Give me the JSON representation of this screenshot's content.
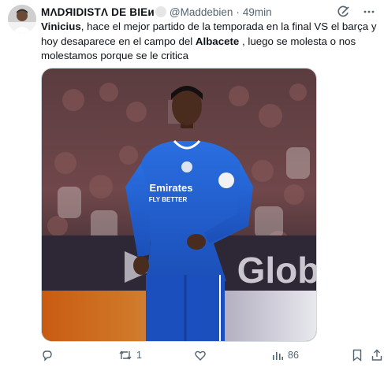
{
  "tweet": {
    "display_name": "MΛDЯIDISTΛ DE BIЕи",
    "handle": "@Maddebien",
    "separator": "·",
    "time": "49min",
    "text": {
      "bold_1": "Vinicius",
      "part_1": ", hace el mejor partido de la temporada en la final VS el barça y hoy desaparece en el campo del ",
      "bold_2": "Albacete",
      "part_2": " , luego se molesta o nos molestamos porque se le critica"
    },
    "media": {
      "jersey_text_1": "Emirates",
      "jersey_text_2": "FLY BETTER",
      "board_text": "Glob"
    },
    "actions": {
      "reply_count": "",
      "retweet_count": "1",
      "like_count": "",
      "views_count": "86"
    }
  },
  "icons": {
    "avatar": "avatar",
    "grok": "grok-icon",
    "more": "more-icon",
    "reply": "reply-icon",
    "retweet": "retweet-icon",
    "like": "heart-icon",
    "views": "views-icon",
    "bookmark": "bookmark-icon",
    "share": "share-icon"
  },
  "colors": {
    "text": "#0f1419",
    "secondary": "#536471",
    "kit_blue": "#1f5fd6"
  }
}
